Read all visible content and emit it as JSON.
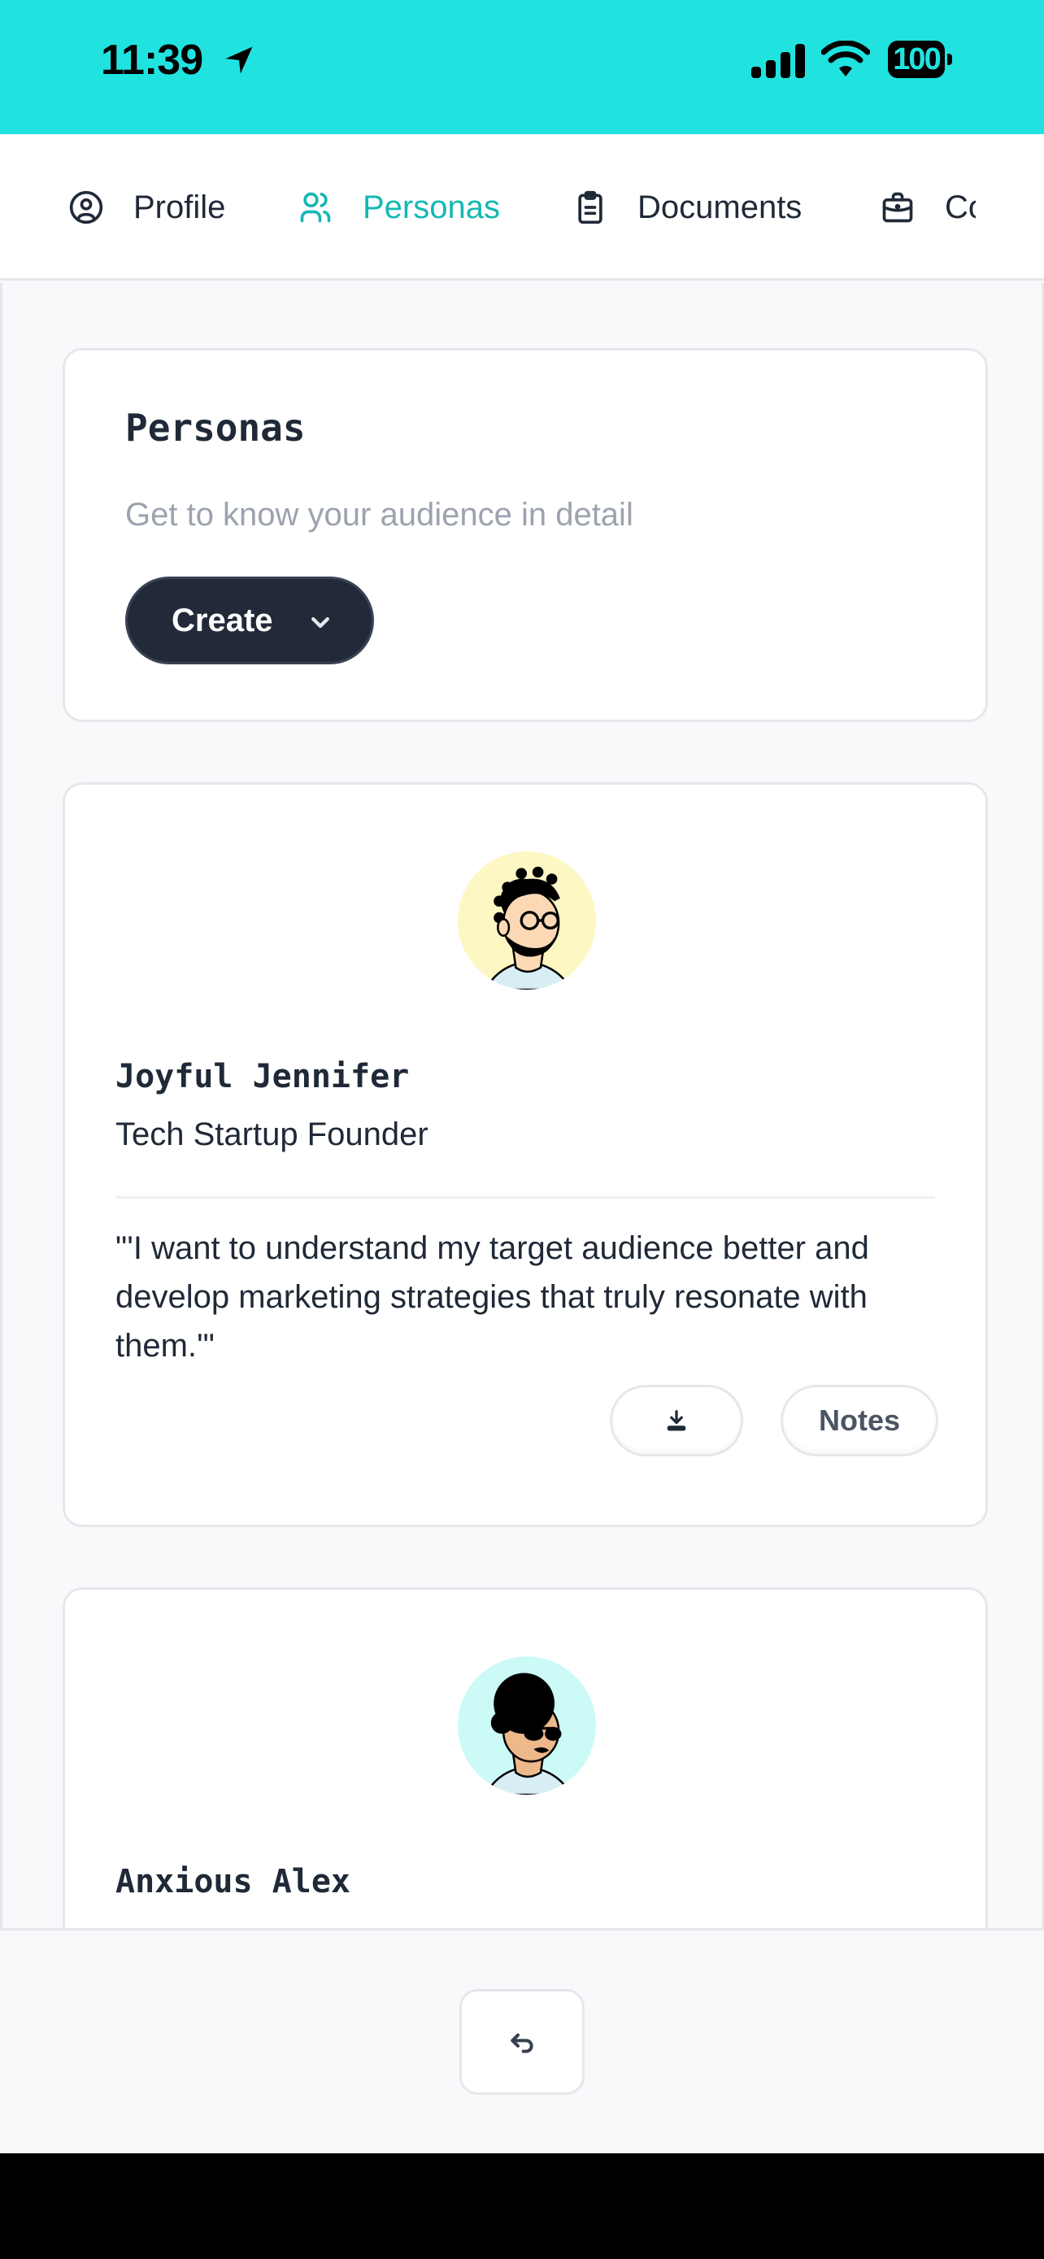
{
  "status_bar": {
    "time": "11:39",
    "battery": "100",
    "icons": [
      "location-arrow-icon",
      "signal-icon",
      "wifi-icon",
      "battery-icon"
    ]
  },
  "tabs": [
    {
      "label": "Profile",
      "icon": "user-circle-icon",
      "active": false
    },
    {
      "label": "Personas",
      "icon": "users-icon",
      "active": true
    },
    {
      "label": "Documents",
      "icon": "clipboard-icon",
      "active": false
    },
    {
      "label": "Co",
      "icon": "briefcase-icon",
      "active": false
    }
  ],
  "header_card": {
    "title": "Personas",
    "subtitle": "Get to know your audience in detail",
    "create_label": "Create"
  },
  "personas": [
    {
      "name": "Joyful Jennifer",
      "role": "Tech Startup Founder",
      "quote": "\"'I want to understand my target audience better and develop marketing strategies that truly resonate with them.'\"",
      "avatar_bg": "#fdf7c4",
      "download_icon": "download-icon",
      "notes_label": "Notes"
    },
    {
      "name": "Anxious Alex",
      "avatar_bg": "#ccfaf6"
    }
  ],
  "bottom": {
    "back_icon": "return-arrow-icon"
  },
  "colors": {
    "status_bar": "#20e3e0",
    "accent": "#14b8b3",
    "primary_button": "#222a3a",
    "muted_text": "#9ca3af"
  }
}
